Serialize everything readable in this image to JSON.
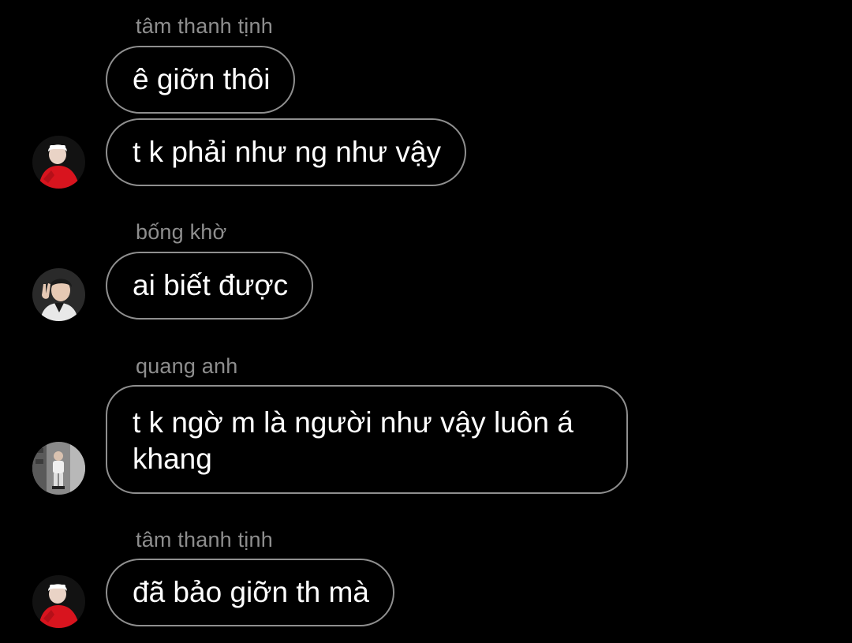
{
  "colors": {
    "background": "#000000",
    "bubble_border": "#8f8f8f",
    "sender_name": "#8e8e8e",
    "message_text": "#ffffff"
  },
  "messages": [
    {
      "sender": "tâm thanh tịnh",
      "bubbles": [
        "ê giỡn thôi",
        "t k phải như ng như vậy"
      ],
      "avatar_icon": "avatar-red-shirt-icon"
    },
    {
      "sender": "bống khờ",
      "bubbles": [
        "ai biết được"
      ],
      "avatar_icon": "avatar-peace-sign-icon"
    },
    {
      "sender": "quang anh",
      "bubbles": [
        "t k ngờ m là người như vậy luôn á khang"
      ],
      "avatar_icon": "avatar-street-photo-icon"
    },
    {
      "sender": "tâm thanh tịnh",
      "bubbles": [
        "đã bảo giỡn th mà"
      ],
      "avatar_icon": "avatar-red-shirt-icon"
    }
  ]
}
